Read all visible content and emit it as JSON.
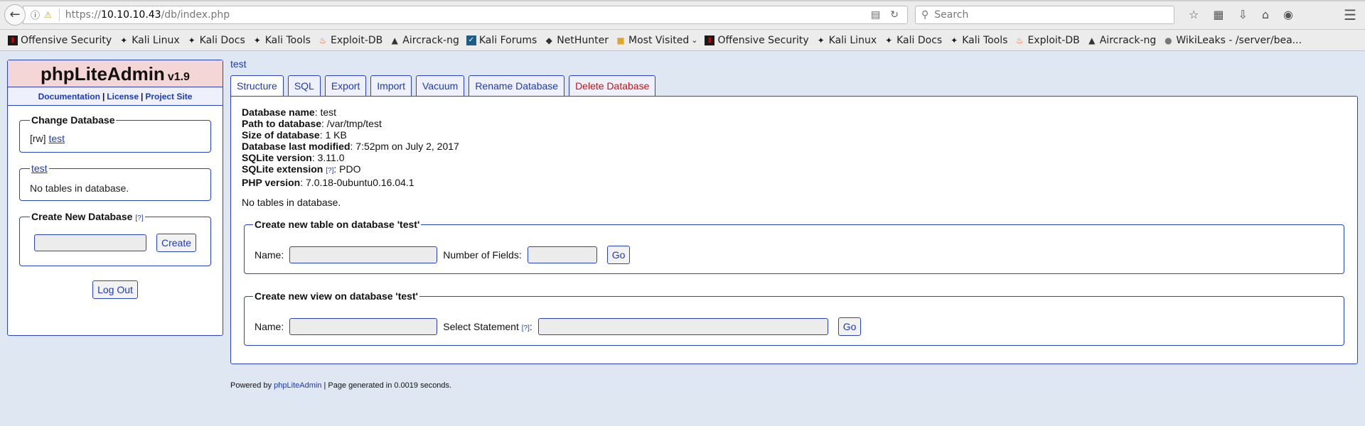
{
  "browser": {
    "url_prefix": "https://",
    "url_host": "10.10.10.43",
    "url_path": "/db/index.php",
    "search_placeholder": "Search",
    "bookmarks": [
      {
        "label": "Offensive Security",
        "icon": "offsec-icon"
      },
      {
        "label": "Kali Linux",
        "icon": "kali-icon"
      },
      {
        "label": "Kali Docs",
        "icon": "kali-icon"
      },
      {
        "label": "Kali Tools",
        "icon": "kali-icon"
      },
      {
        "label": "Exploit-DB",
        "icon": "exploitdb-icon"
      },
      {
        "label": "Aircrack-ng",
        "icon": "aircrack-icon"
      },
      {
        "label": "Kali Forums",
        "icon": "kali-forums-icon"
      },
      {
        "label": "NetHunter",
        "icon": "nethunter-icon"
      },
      {
        "label": "Most Visited",
        "icon": "folder-icon"
      },
      {
        "label": "Offensive Security",
        "icon": "offsec-icon"
      },
      {
        "label": "Kali Linux",
        "icon": "kali-icon"
      },
      {
        "label": "Kali Docs",
        "icon": "kali-icon"
      },
      {
        "label": "Kali Tools",
        "icon": "kali-icon"
      },
      {
        "label": "Exploit-DB",
        "icon": "exploitdb-icon"
      },
      {
        "label": "Aircrack-ng",
        "icon": "aircrack-icon"
      },
      {
        "label": "WikiLeaks - /server/bea...",
        "icon": "globe-icon"
      }
    ]
  },
  "sidebar": {
    "app_name": "phpLiteAdmin",
    "version": "v1.9",
    "links": [
      "Documentation",
      "License",
      "Project Site"
    ],
    "change_db": {
      "legend": "Change Database",
      "perm": "[rw]",
      "db": "test"
    },
    "current_db": {
      "legend": "test",
      "text": "No tables in database."
    },
    "create_db": {
      "legend": "Create New Database",
      "help": "[?]",
      "button": "Create"
    },
    "logout": "Log Out"
  },
  "main": {
    "breadcrumb": "test",
    "tabs": [
      "Structure",
      "SQL",
      "Export",
      "Import",
      "Vacuum",
      "Rename Database",
      "Delete Database"
    ],
    "info": {
      "name_label": "Database name",
      "name": ": test",
      "path_label": "Path to database",
      "path": ": /var/tmp/test",
      "size_label": "Size of database",
      "size": ": 1 KB",
      "modified_label": "Database last modified",
      "modified": ": 7:52pm on July 2, 2017",
      "sqlite_label": "SQLite version",
      "sqlite": ": 3.11.0",
      "ext_label": "SQLite extension",
      "ext_help": "[?]",
      "ext": ": PDO",
      "php_label": "PHP version",
      "php": ": 7.0.18-0ubuntu0.16.04.1"
    },
    "no_tables": "No tables in database.",
    "create_table": {
      "legend": "Create new table on database 'test'",
      "name_label": "Name:",
      "fields_label": "Number of Fields:",
      "go": "Go"
    },
    "create_view": {
      "legend": "Create new view on database 'test'",
      "name_label": "Name:",
      "select_label": "Select Statement",
      "select_help": "[?]",
      "colon": ":",
      "go": "Go"
    }
  },
  "footer": {
    "prefix": "Powered by ",
    "link": "phpLiteAdmin",
    "suffix": " | Page generated in 0.0019 seconds."
  }
}
